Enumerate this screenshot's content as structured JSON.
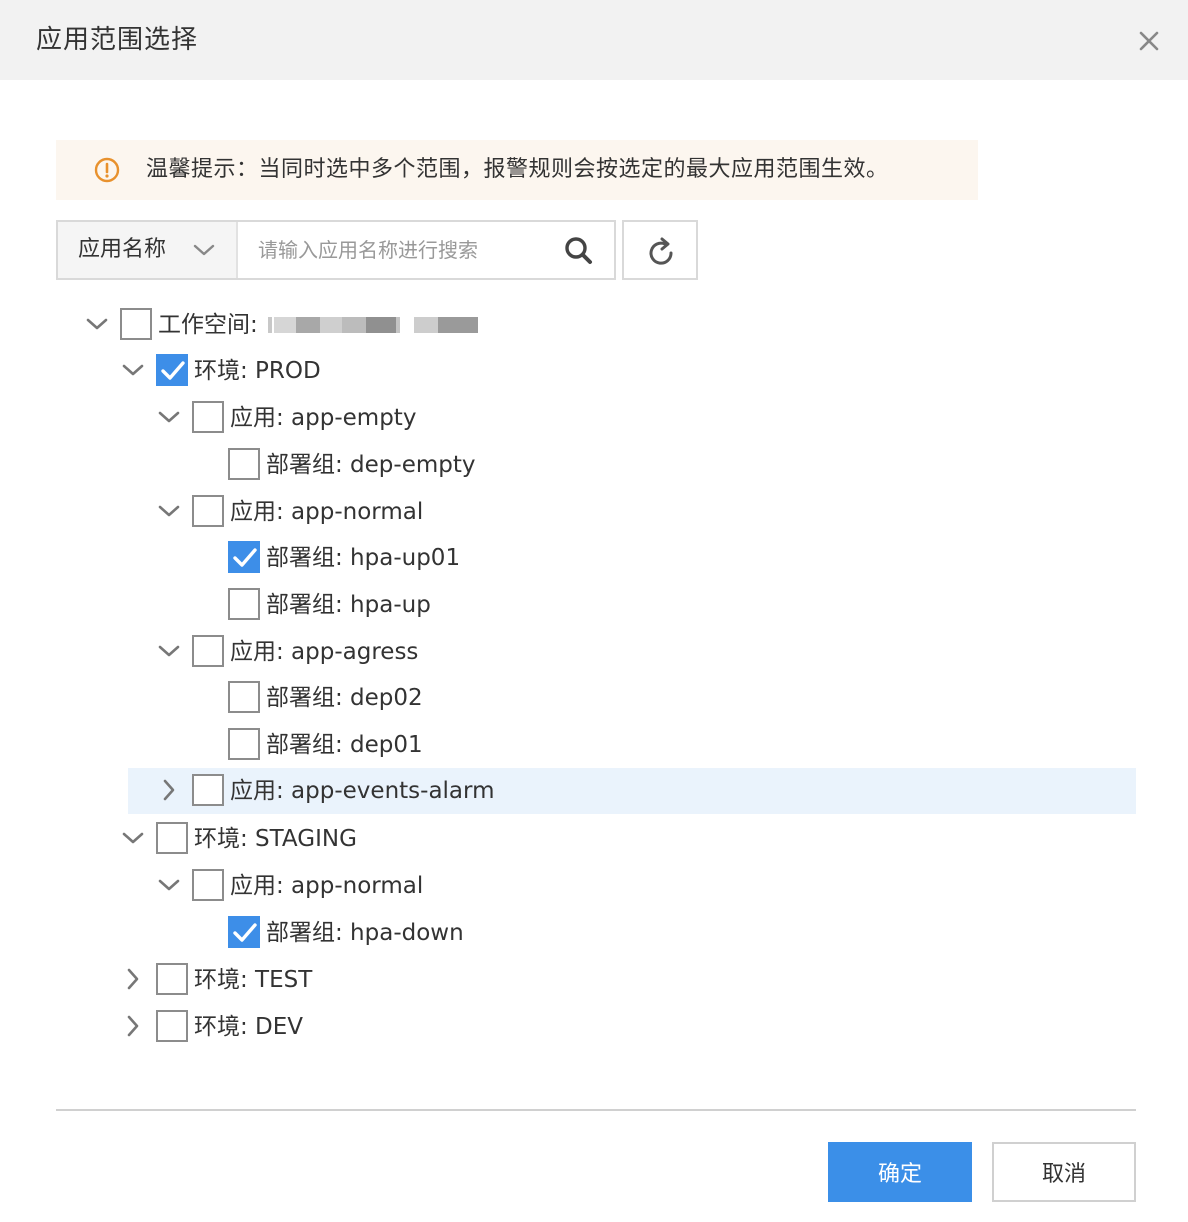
{
  "dialog": {
    "title": "应用范围选择",
    "close_icon": "close-icon"
  },
  "tip": {
    "icon": "warning-circle-icon",
    "text": "温馨提示：当同时选中多个范围，报警规则会按选定的最大应用范围生效。",
    "color": "#e8912d"
  },
  "search": {
    "type_label": "应用名称",
    "placeholder": "请输入应用名称进行搜索",
    "value": "",
    "search_icon": "search-icon",
    "refresh_icon": "refresh-icon"
  },
  "tree": {
    "workspace": {
      "label": "工作空间: ",
      "checked": false,
      "expanded": true,
      "redacted": true
    },
    "envs": [
      {
        "label": "环境: PROD",
        "checked": true,
        "expanded": true,
        "apps": [
          {
            "label": "应用: app-empty",
            "checked": false,
            "expanded": true,
            "groups": [
              {
                "label": "部署组: dep-empty",
                "checked": false
              }
            ]
          },
          {
            "label": "应用: app-normal",
            "checked": false,
            "expanded": true,
            "groups": [
              {
                "label": "部署组: hpa-up01",
                "checked": true
              },
              {
                "label": "部署组: hpa-up",
                "checked": false
              }
            ]
          },
          {
            "label": "应用: app-agress",
            "checked": false,
            "expanded": true,
            "groups": [
              {
                "label": "部署组: dep02",
                "checked": false
              },
              {
                "label": "部署组: dep01",
                "checked": false
              }
            ]
          },
          {
            "label": "应用: app-events-alarm",
            "checked": false,
            "expanded": false,
            "highlighted": true,
            "groups": []
          }
        ]
      },
      {
        "label": "环境: STAGING",
        "checked": false,
        "expanded": true,
        "apps": [
          {
            "label": "应用: app-normal",
            "checked": false,
            "expanded": true,
            "groups": [
              {
                "label": "部署组: hpa-down",
                "checked": true
              }
            ]
          }
        ]
      },
      {
        "label": "环境: TEST",
        "checked": false,
        "expanded": false,
        "apps": []
      },
      {
        "label": "环境: DEV",
        "checked": false,
        "expanded": false,
        "apps": []
      }
    ]
  },
  "footer": {
    "ok_label": "确定",
    "cancel_label": "取消"
  },
  "colors": {
    "primary": "#3b8fe8",
    "highlight_row": "#eaf3fc",
    "tip_bg": "#fcf6ef"
  }
}
